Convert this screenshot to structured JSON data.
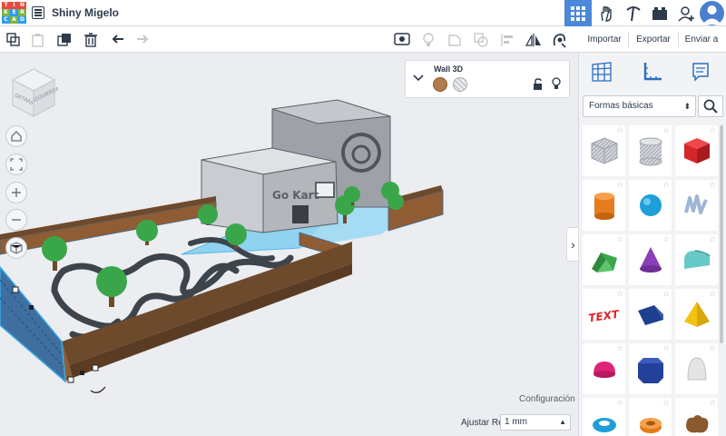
{
  "app": {
    "logo_letters": [
      "T",
      "I",
      "N",
      "K",
      "E",
      "R",
      "C",
      "A",
      "D"
    ],
    "design_title": "Shiny Migelo"
  },
  "colors": {
    "logo_t": "#e84b3c",
    "logo_i": "#7cb342",
    "logo_n": "#2a9df4",
    "accent_blue": "#4a88d9",
    "wall_brown": "#8f5c33",
    "selection_blue": "#3aa9e8"
  },
  "toolbar": {
    "icons": [
      "copy-icon",
      "paste-icon",
      "duplicate-icon",
      "delete-icon",
      "undo-icon",
      "redo-icon",
      "note-icon",
      "light-bulb-icon",
      "shape-outline-icon",
      "group-icon",
      "align-icon",
      "mirror-icon",
      "cruise-icon"
    ]
  },
  "side_actions": {
    "import_label": "Importar",
    "export_label": "Exportar",
    "send_label": "Enviar a"
  },
  "viewcube": {
    "face_left": "DETRÁS",
    "face_right": "IZQUIERDA"
  },
  "inspector": {
    "shape_name": "Wall 3D",
    "solid_color": "#b07c4a"
  },
  "scene": {
    "building_sign": "Go Kart"
  },
  "workplane": {
    "settings_label": "Configuración",
    "snap_label": "Ajustar Rejilla",
    "snap_value": "1 mm"
  },
  "panel": {
    "category": "Formas básicas",
    "shapes": [
      {
        "name": "box-hole",
        "color": "#b8bcc4"
      },
      {
        "name": "cylinder-hole",
        "color": "#c2c6cc"
      },
      {
        "name": "box",
        "color": "#d7262b"
      },
      {
        "name": "cylinder",
        "color": "#e67c1c"
      },
      {
        "name": "sphere",
        "color": "#1e9fd8"
      },
      {
        "name": "scribble",
        "color": "#9fb6d6"
      },
      {
        "name": "roof",
        "color": "#3aa64a"
      },
      {
        "name": "cone",
        "color": "#8a3fb8"
      },
      {
        "name": "round-roof",
        "color": "#68c9c9"
      },
      {
        "name": "text",
        "color": "#d7262b"
      },
      {
        "name": "wedge",
        "color": "#1f3f8f"
      },
      {
        "name": "pyramid",
        "color": "#f2c215"
      },
      {
        "name": "half-sphere",
        "color": "#e0237a"
      },
      {
        "name": "polygon",
        "color": "#24419a"
      },
      {
        "name": "paraboloid",
        "color": "#dcdcdc"
      },
      {
        "name": "torus",
        "color": "#1e9fd8"
      },
      {
        "name": "tube",
        "color": "#e67c1c"
      },
      {
        "name": "organic",
        "color": "#8a5a2e"
      }
    ]
  }
}
